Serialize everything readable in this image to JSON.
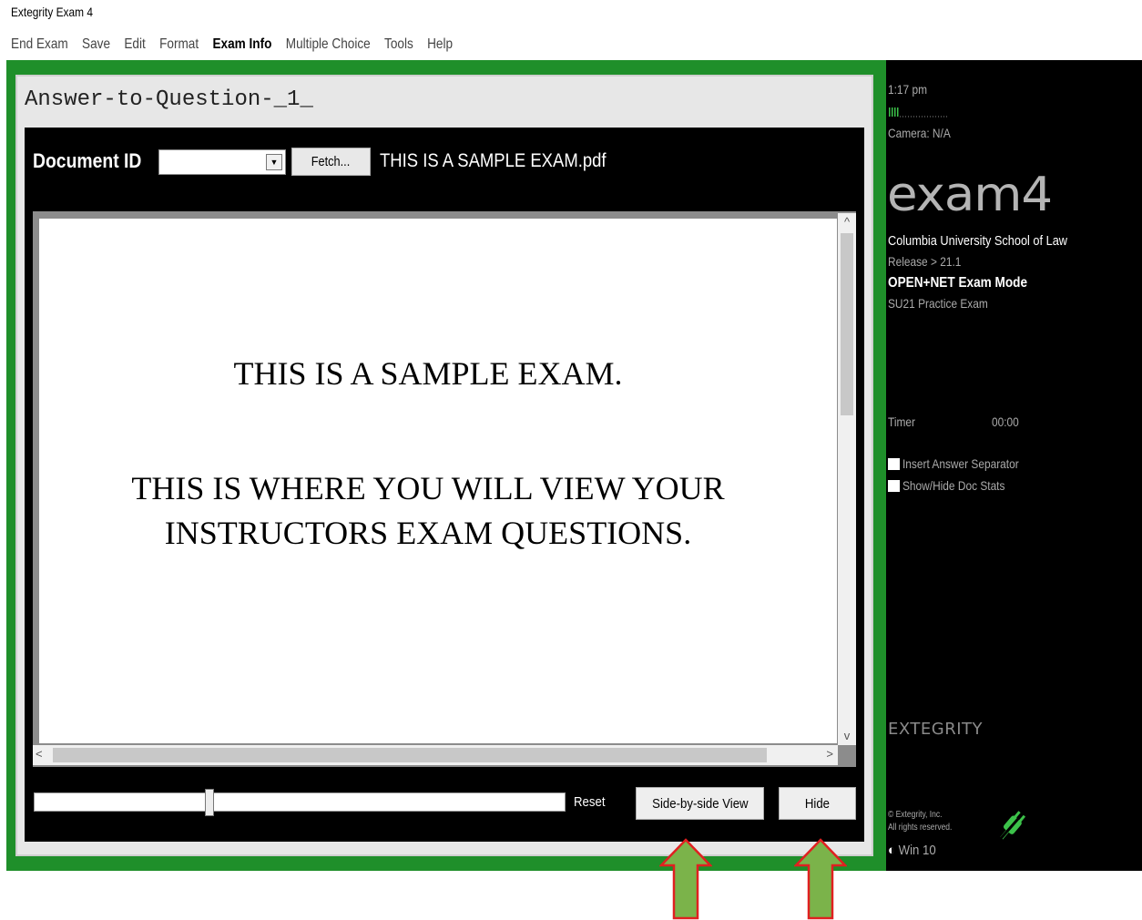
{
  "window": {
    "title": "Extegrity Exam 4"
  },
  "menu": {
    "items": [
      "End Exam",
      "Save",
      "Edit",
      "Format",
      "Exam Info",
      "Multiple Choice",
      "Tools",
      "Help"
    ],
    "active": "Exam Info"
  },
  "answer_title": "Answer-to-Question-_1_",
  "toolbar": {
    "doc_id_label": "Document ID",
    "doc_id_value": "",
    "fetch_label": "Fetch...",
    "filename": "THIS IS A SAMPLE EXAM.pdf"
  },
  "document": {
    "line1": "THIS IS A SAMPLE EXAM.",
    "line2": "THIS IS WHERE YOU WILL VIEW YOUR",
    "line3": "INSTRUCTORS EXAM QUESTIONS."
  },
  "controls": {
    "reset_label": "Reset",
    "side_by_side_label": "Side-by-side View",
    "hide_label": "Hide",
    "slider_value": 0.33
  },
  "sidebar": {
    "time": "1:17 pm",
    "camera": "Camera: N/A",
    "logo": "exam4",
    "school": "Columbia University School of Law",
    "release": "Release > 21.1",
    "mode": "OPEN+NET Exam Mode",
    "exam_name": "SU21 Practice Exam",
    "timer_label": "Timer",
    "timer_value": "00:00",
    "insert_separator_label": "Insert Answer Separator",
    "doc_stats_label": "Show/Hide Doc Stats",
    "brand": "EXTEGRITY",
    "copyright_line1": "© Extegrity, Inc.",
    "copyright_line2": "All rights reserved.",
    "os_label": "Win 10"
  },
  "colors": {
    "frame_green": "#1f8f2a",
    "arrow_green": "#7bb34a",
    "arrow_red": "#e02020",
    "plug_green": "#3cc24a"
  },
  "icons": [
    "scroll-up-icon",
    "scroll-down-icon",
    "scroll-left-icon",
    "scroll-right-icon",
    "dropdown-arrow-icon",
    "signal-strength-icon",
    "plug-icon",
    "half-circle-icon",
    "up-arrow-annotation-icon"
  ]
}
